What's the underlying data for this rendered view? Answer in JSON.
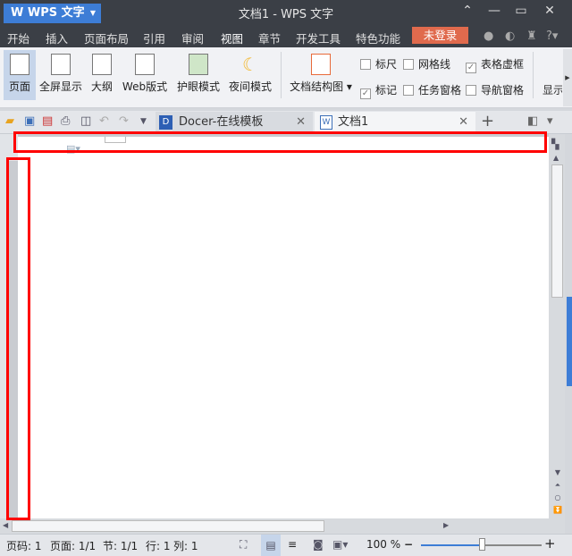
{
  "titlebar": {
    "app_button": "WPS 文字",
    "title": "文档1 - WPS 文字"
  },
  "menu": [
    "开始",
    "插入",
    "页面布局",
    "引用",
    "审阅",
    "视图",
    "章节",
    "开发工具",
    "特色功能"
  ],
  "active_menu": "视图",
  "login": "未登录",
  "ribbon": {
    "buttons": [
      "页面",
      "全屏显示",
      "大纲",
      "Web版式",
      "护眼模式",
      "夜间模式",
      "文档结构图"
    ],
    "selected": "页面",
    "more": "显示",
    "checkboxes": [
      {
        "label": "标尺",
        "checked": false
      },
      {
        "label": "网格线",
        "checked": false
      },
      {
        "label": "表格虚框",
        "checked": true
      },
      {
        "label": "标记",
        "checked": true
      },
      {
        "label": "任务窗格",
        "checked": false
      },
      {
        "label": "导航窗格",
        "checked": false
      }
    ]
  },
  "tabs": [
    {
      "label": "Docer-在线模板"
    },
    {
      "label": "文档1"
    }
  ],
  "status": {
    "page": "页码: 1",
    "pages": "页面: 1/1",
    "section": "节: 1/1",
    "line": "行: 1",
    "col": "列: 1",
    "zoom": "100 %",
    "zoom_slider_percent": 50
  },
  "colors": {
    "accent": "#3d7dd6",
    "login": "#e06a4d",
    "titlebar": "#3b3f46",
    "annotation": "#ff0000"
  }
}
